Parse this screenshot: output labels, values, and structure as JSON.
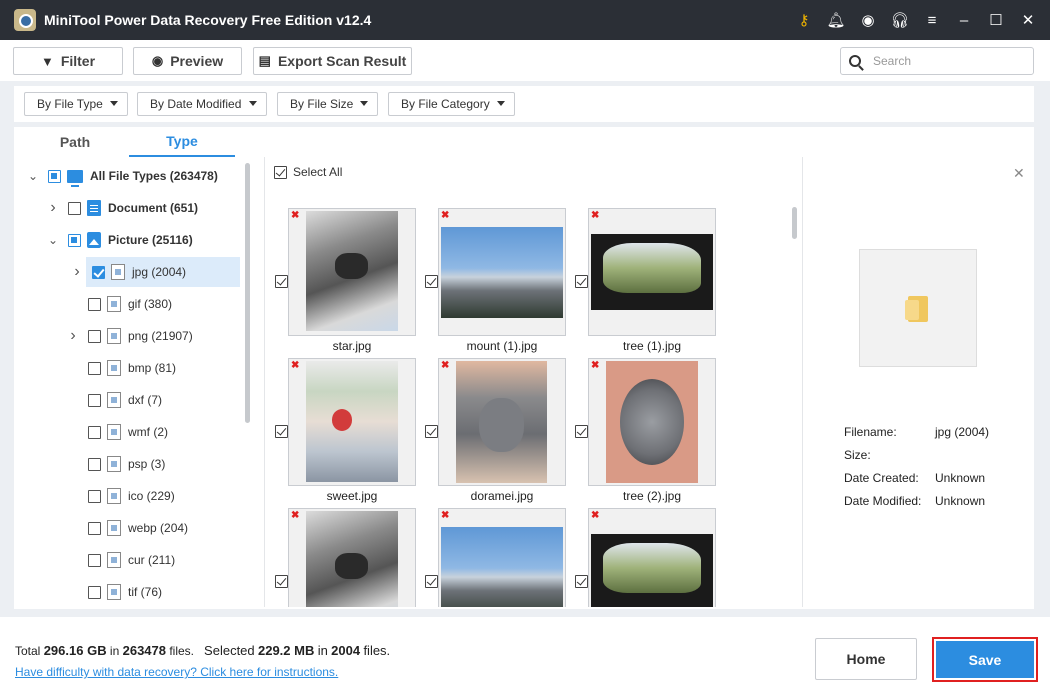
{
  "app": {
    "title": "MiniTool Power Data Recovery Free Edition v12.4"
  },
  "title_icons": [
    {
      "name": "key-icon",
      "glyph": "⚷"
    },
    {
      "name": "bell-icon",
      "glyph": "🔔︎"
    },
    {
      "name": "disc-icon",
      "glyph": "◉"
    },
    {
      "name": "headset-icon",
      "glyph": "🎧︎"
    },
    {
      "name": "menu-icon",
      "glyph": "≡"
    },
    {
      "name": "minimize-icon",
      "glyph": "–"
    },
    {
      "name": "maximize-icon",
      "glyph": "☐"
    },
    {
      "name": "close-icon",
      "glyph": "✕"
    }
  ],
  "toolbar": {
    "filter": "Filter",
    "preview": "Preview",
    "export": "Export Scan Result",
    "search_placeholder": "Search"
  },
  "filters": {
    "file_type": "By File Type",
    "date_modified": "By Date Modified",
    "file_size": "By File Size",
    "file_category": "By File Category"
  },
  "tabs": {
    "path": "Path",
    "type": "Type",
    "active": "Type"
  },
  "tree": [
    {
      "label": "All File Types (263478)",
      "expand": "down",
      "state": "partial",
      "icon": "pc",
      "bold": true
    },
    {
      "label": "Document (651)",
      "expand": "right",
      "state": "none",
      "icon": "doc",
      "bold": true
    },
    {
      "label": "Picture (25116)",
      "expand": "down",
      "state": "partial",
      "icon": "pic",
      "bold": true
    },
    {
      "label": "jpg (2004)",
      "expand": "right",
      "state": "checked",
      "icon": "file",
      "selected": true
    },
    {
      "label": "gif (380)",
      "expand": "",
      "state": "none",
      "icon": "file"
    },
    {
      "label": "png (21907)",
      "expand": "right",
      "state": "none",
      "icon": "file"
    },
    {
      "label": "bmp (81)",
      "expand": "",
      "state": "none",
      "icon": "file"
    },
    {
      "label": "dxf (7)",
      "expand": "",
      "state": "none",
      "icon": "file"
    },
    {
      "label": "wmf (2)",
      "expand": "",
      "state": "none",
      "icon": "file"
    },
    {
      "label": "psp (3)",
      "expand": "",
      "state": "none",
      "icon": "file"
    },
    {
      "label": "ico (229)",
      "expand": "",
      "state": "none",
      "icon": "file"
    },
    {
      "label": "webp (204)",
      "expand": "",
      "state": "none",
      "icon": "file"
    },
    {
      "label": "cur (211)",
      "expand": "",
      "state": "none",
      "icon": "file"
    },
    {
      "label": "tif (76)",
      "expand": "",
      "state": "none",
      "icon": "file"
    }
  ],
  "grid": {
    "select_all": "Select All",
    "files": [
      {
        "name": "star.jpg",
        "image": "cat"
      },
      {
        "name": "mount (1).jpg",
        "image": "mount"
      },
      {
        "name": "tree (1).jpg",
        "image": "tree"
      },
      {
        "name": "sweet.jpg",
        "image": "sweet"
      },
      {
        "name": "doramei.jpg",
        "image": "dora"
      },
      {
        "name": "tree (2).jpg",
        "image": "tree2"
      },
      {
        "name": "",
        "image": "cat"
      },
      {
        "name": "",
        "image": "mount"
      },
      {
        "name": "",
        "image": "tree"
      }
    ]
  },
  "details": {
    "filename_label": "Filename:",
    "filename_value": "jpg (2004)",
    "size_label": "Size:",
    "size_value": "",
    "created_label": "Date Created:",
    "created_value": "Unknown",
    "modified_label": "Date Modified:",
    "modified_value": "Unknown"
  },
  "footer": {
    "total_prefix": "Total",
    "total_size": "296.16 GB",
    "in_word": "in",
    "total_files": "263478",
    "files_word": "files.",
    "selected_prefix": "Selected",
    "selected_size": "229.2 MB",
    "in_word2": "in",
    "selected_files": "2004",
    "files_word2": "files.",
    "help_link": "Have difficulty with data recovery? Click here for instructions.",
    "home": "Home",
    "save": "Save"
  },
  "colors": {
    "accent": "#2c8de0",
    "titlebar": "#2b2f36",
    "highlight": "#e02020"
  }
}
